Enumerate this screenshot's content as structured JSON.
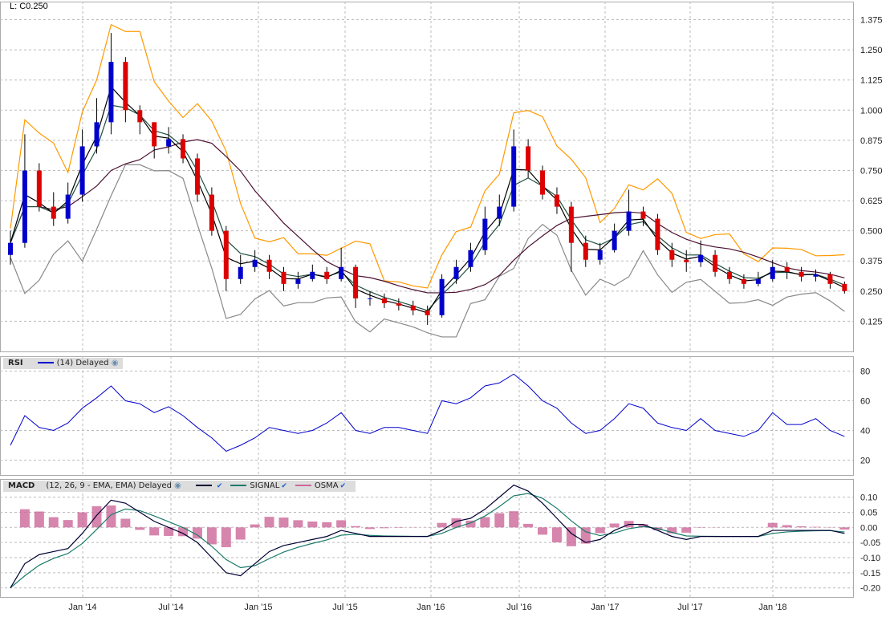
{
  "header": {
    "last": "L: C0.250"
  },
  "rsi_header": {
    "name": "RSI",
    "params": "(14) Delayed"
  },
  "macd_header": {
    "name": "MACD",
    "params": "(12, 26, 9 - EMA, EMA) Delayed",
    "signal": "SIGNAL",
    "osma": "OSMA"
  },
  "colors": {
    "up": "#0000cc",
    "down": "#dd0000",
    "upper": "#ff9900",
    "lower": "#888888",
    "ema_short": "#000000",
    "ema_mid": "#1f4f3f",
    "sma_long": "#4a1030",
    "rsi": "#0000cc",
    "macd": "#000033",
    "signal": "#1a7a6a",
    "osma": "#cc6699"
  },
  "chart_data": [
    {
      "type": "candlestick",
      "title": "Price",
      "ylim": [
        0,
        1.45
      ],
      "yticks": [
        0.125,
        0.25,
        0.375,
        0.5,
        0.625,
        0.75,
        0.875,
        1.0,
        1.125,
        1.25,
        1.375
      ],
      "ytick_labels": [
        "0.125",
        "0.250",
        "0.375",
        "0.500",
        "0.625",
        "0.750",
        "0.875",
        "1.000",
        "1.125",
        "1.250",
        "1.375"
      ],
      "x_labels": [
        "Jan '14",
        "Jul '14",
        "Jan '15",
        "Jul '15",
        "Jan '16",
        "Jul '16",
        "Jan '17",
        "Jul '17",
        "Jan '18"
      ],
      "periods": [
        "2013-08",
        "2013-09",
        "2013-10",
        "2013-11",
        "2013-12",
        "2014-01",
        "2014-02",
        "2014-03",
        "2014-04",
        "2014-05",
        "2014-06",
        "2014-07",
        "2014-08",
        "2014-09",
        "2014-10",
        "2014-11",
        "2014-12",
        "2015-01",
        "2015-02",
        "2015-03",
        "2015-04",
        "2015-05",
        "2015-06",
        "2015-07",
        "2015-08",
        "2015-09",
        "2015-10",
        "2015-11",
        "2015-12",
        "2016-01",
        "2016-02",
        "2016-03",
        "2016-04",
        "2016-05",
        "2016-06",
        "2016-07",
        "2016-08",
        "2016-09",
        "2016-10",
        "2016-11",
        "2016-12",
        "2017-01",
        "2017-02",
        "2017-03",
        "2017-04",
        "2017-05",
        "2017-06",
        "2017-07",
        "2017-08",
        "2017-09",
        "2017-10",
        "2017-11",
        "2017-12",
        "2018-01",
        "2018-02",
        "2018-03",
        "2018-04",
        "2018-05",
        "2018-06"
      ],
      "close": [
        0.45,
        0.75,
        0.6,
        0.55,
        0.65,
        0.85,
        0.95,
        1.2,
        1.0,
        0.95,
        0.85,
        0.88,
        0.8,
        0.65,
        0.5,
        0.3,
        0.35,
        0.38,
        0.33,
        0.28,
        0.3,
        0.33,
        0.3,
        0.35,
        0.22,
        0.22,
        0.2,
        0.19,
        0.17,
        0.15,
        0.3,
        0.35,
        0.42,
        0.55,
        0.6,
        0.85,
        0.75,
        0.65,
        0.6,
        0.45,
        0.38,
        0.42,
        0.5,
        0.58,
        0.55,
        0.42,
        0.38,
        0.37,
        0.4,
        0.33,
        0.3,
        0.28,
        0.3,
        0.35,
        0.33,
        0.31,
        0.32,
        0.28,
        0.25
      ],
      "open": [
        0.4,
        0.45,
        0.75,
        0.6,
        0.55,
        0.65,
        0.85,
        0.95,
        1.2,
        1.0,
        0.95,
        0.85,
        0.88,
        0.8,
        0.65,
        0.5,
        0.3,
        0.35,
        0.38,
        0.33,
        0.28,
        0.3,
        0.33,
        0.3,
        0.35,
        0.22,
        0.22,
        0.2,
        0.19,
        0.17,
        0.15,
        0.3,
        0.35,
        0.42,
        0.55,
        0.6,
        0.85,
        0.75,
        0.65,
        0.6,
        0.45,
        0.38,
        0.42,
        0.5,
        0.58,
        0.55,
        0.42,
        0.38,
        0.37,
        0.4,
        0.33,
        0.3,
        0.28,
        0.3,
        0.35,
        0.33,
        0.31,
        0.32,
        0.28
      ],
      "high": [
        0.5,
        0.9,
        0.78,
        0.66,
        0.7,
        0.92,
        1.05,
        1.32,
        1.22,
        1.02,
        0.95,
        0.93,
        0.9,
        0.82,
        0.68,
        0.52,
        0.4,
        0.42,
        0.4,
        0.35,
        0.33,
        0.36,
        0.35,
        0.43,
        0.36,
        0.25,
        0.24,
        0.22,
        0.21,
        0.19,
        0.32,
        0.38,
        0.45,
        0.6,
        0.65,
        0.92,
        0.88,
        0.77,
        0.68,
        0.62,
        0.48,
        0.45,
        0.53,
        0.67,
        0.6,
        0.57,
        0.45,
        0.42,
        0.46,
        0.42,
        0.35,
        0.32,
        0.33,
        0.38,
        0.37,
        0.35,
        0.34,
        0.33,
        0.29
      ],
      "low": [
        0.36,
        0.43,
        0.58,
        0.52,
        0.53,
        0.62,
        0.82,
        0.9,
        0.95,
        0.9,
        0.8,
        0.82,
        0.78,
        0.62,
        0.48,
        0.25,
        0.28,
        0.33,
        0.3,
        0.25,
        0.26,
        0.29,
        0.28,
        0.29,
        0.18,
        0.19,
        0.18,
        0.17,
        0.15,
        0.11,
        0.14,
        0.28,
        0.33,
        0.4,
        0.52,
        0.58,
        0.72,
        0.63,
        0.57,
        0.33,
        0.35,
        0.36,
        0.41,
        0.48,
        0.52,
        0.4,
        0.35,
        0.33,
        0.35,
        0.31,
        0.28,
        0.26,
        0.27,
        0.29,
        0.3,
        0.29,
        0.29,
        0.26,
        0.24
      ]
    },
    {
      "type": "line",
      "title": "RSI",
      "ylim": [
        10,
        90
      ],
      "yticks": [
        20,
        40,
        60,
        80
      ],
      "ytick_labels": [
        "20",
        "40",
        "60",
        "80"
      ],
      "values": [
        30,
        50,
        42,
        40,
        45,
        55,
        62,
        70,
        60,
        58,
        52,
        56,
        50,
        42,
        35,
        26,
        30,
        35,
        42,
        40,
        38,
        40,
        45,
        52,
        40,
        38,
        42,
        42,
        40,
        38,
        60,
        58,
        62,
        70,
        72,
        78,
        70,
        60,
        55,
        45,
        38,
        40,
        48,
        58,
        55,
        45,
        42,
        40,
        48,
        40,
        38,
        36,
        40,
        52,
        44,
        44,
        48,
        40,
        36
      ]
    },
    {
      "type": "line",
      "title": "MACD",
      "ylim": [
        -0.23,
        0.16
      ],
      "yticks": [
        0.1,
        0.05,
        0.0,
        -0.05,
        -0.1,
        -0.15,
        -0.2
      ],
      "ytick_labels": [
        "0.10",
        "0.05",
        "0.00",
        "-0.05",
        "-0.10",
        "-0.15",
        "-0.20"
      ],
      "macd": [
        -0.2,
        -0.12,
        -0.09,
        -0.08,
        -0.07,
        -0.02,
        0.04,
        0.09,
        0.08,
        0.05,
        0.02,
        0.0,
        -0.02,
        -0.05,
        -0.1,
        -0.15,
        -0.16,
        -0.12,
        -0.08,
        -0.06,
        -0.05,
        -0.04,
        -0.03,
        -0.01,
        -0.02,
        -0.03,
        -0.03,
        -0.03,
        -0.03,
        -0.03,
        -0.01,
        0.02,
        0.03,
        0.06,
        0.1,
        0.14,
        0.12,
        0.08,
        0.03,
        -0.02,
        -0.05,
        -0.04,
        -0.01,
        0.01,
        0.01,
        -0.01,
        -0.03,
        -0.04,
        -0.03,
        -0.03,
        -0.03,
        -0.03,
        -0.03,
        -0.01,
        -0.01,
        -0.01,
        -0.01,
        -0.01,
        -0.02
      ]
    }
  ]
}
